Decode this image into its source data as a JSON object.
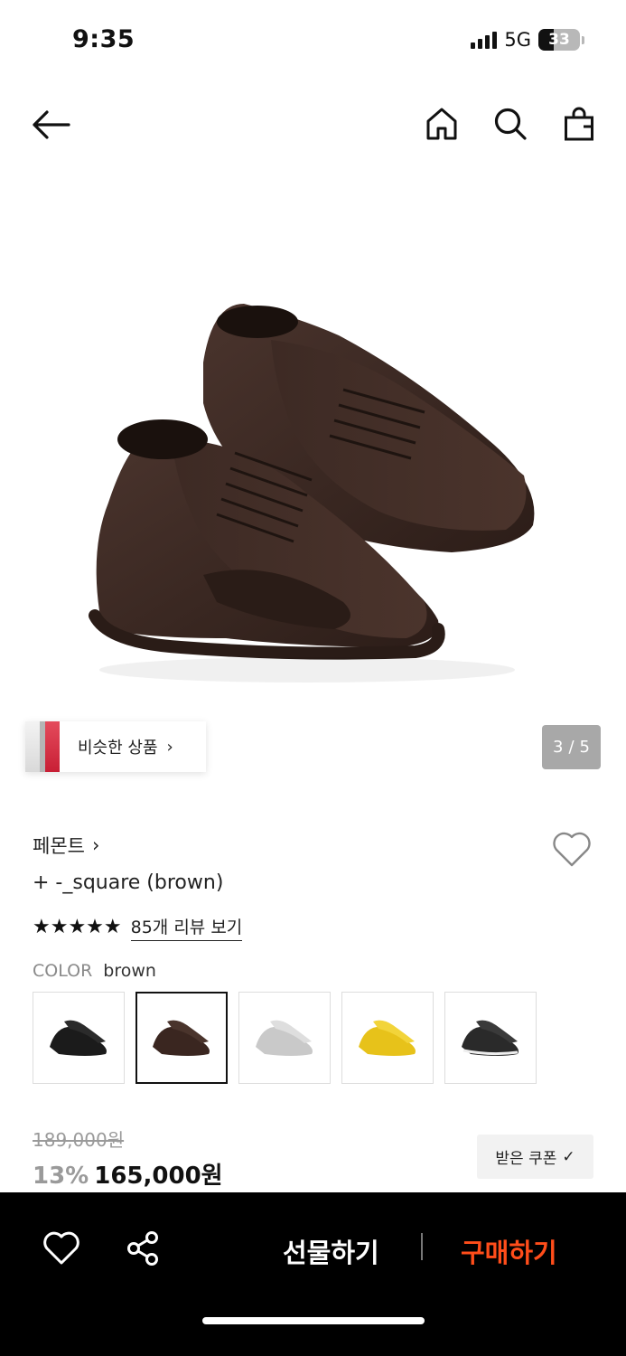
{
  "status": {
    "time": "9:35",
    "network": "5G",
    "battery": "33",
    "battery_level": 0.33
  },
  "nav": {
    "back_icon": "arrow-left-icon",
    "home_icon": "home-icon",
    "search_icon": "search-icon",
    "cart_icon": "shopping-bag-icon"
  },
  "gallery": {
    "current": "3",
    "separator": "/",
    "total": "5",
    "similar_label": "비슷한 상품",
    "similar_chevron": "›"
  },
  "product": {
    "brand": "페몬트",
    "brand_chevron": "›",
    "name": "+ -_square (brown)",
    "rating": 5,
    "stars": "★★★★★",
    "review_link": "85개 리뷰 보기",
    "color_label": "COLOR",
    "color_value": "brown",
    "swatches": [
      {
        "name": "black",
        "color": "#1b1b1b"
      },
      {
        "name": "brown",
        "color": "#3a2620",
        "selected": true
      },
      {
        "name": "silver",
        "color": "#c9c9c9"
      },
      {
        "name": "yellow",
        "color": "#e7c21a"
      },
      {
        "name": "black-white",
        "color": "#2a2a2a"
      }
    ],
    "original_price": "189,000원",
    "discount": "13%",
    "price": "165,000원",
    "coupon_label": "받은 쿠폰",
    "coupon_check": "✓"
  },
  "bottom_bar": {
    "wish_icon": "heart-icon",
    "share_icon": "share-icon",
    "gift_label": "선물하기",
    "buy_label": "구매하기",
    "buy_color": "#ff4d1a"
  }
}
